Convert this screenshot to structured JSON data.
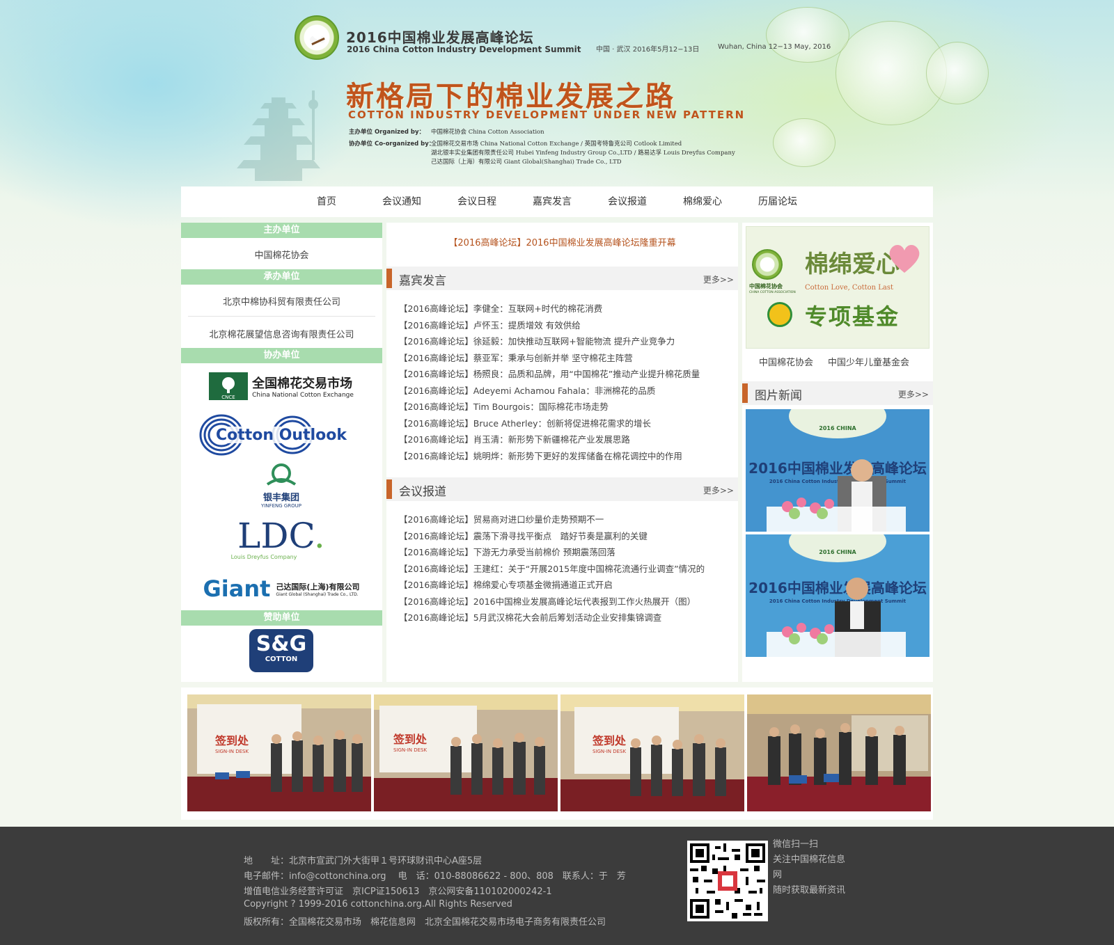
{
  "header": {
    "summit_cn": "2016中国棉业发展高峰论坛",
    "summit_en": "2016 China Cotton Industry Development Summit",
    "date_cn": "中国 · 武汉  2016年5月12−13日",
    "date_en": "Wuhan, China  12−13  May, 2016",
    "slogan_cn": "新格局下的棉业发展之路",
    "slogan_en": "COTTON INDUSTRY DEVELOPMENT UNDER NEW PATTERN",
    "organized_label": "主办单位  Organized by：",
    "organized_value": "中国棉花协会  China Cotton Association",
    "coorganized_label": "协办单位  Co-organized by：",
    "coorganized_line1": "全国棉花交易市场  China National Cotton Exchange   /   英国考特鲁克公司  Cotlook Limited",
    "coorganized_line2": "湖北银丰实业集团有限责任公司  Hubei Yinfeng Industry Group Co.,LTD   /   路易达孚  Louis Dreyfus Company",
    "coorganized_line3": "己达国际（上海）有限公司  Giant Global(Shanghai) Trade Co., LTD"
  },
  "nav": {
    "items": [
      "首页",
      "会议通知",
      "会议日程",
      "嘉宾发言",
      "会议报道",
      "棉绵爱心",
      "历届论坛"
    ]
  },
  "left": {
    "host_title": "主办单位",
    "host_items": [
      "中国棉花协会"
    ],
    "undertake_title": "承办单位",
    "undertake_items": [
      "北京中棉协科贸有限责任公司",
      "北京棉花展望信息咨询有限责任公司"
    ],
    "coorg_title": "协办单位",
    "sponsor_title": "赞助单位",
    "logos": {
      "cnce_cn": "全国棉花交易市场",
      "cnce_en": "China National Cotton Exchange",
      "cnce_mark": "CNCE",
      "cotlook": "Cotton Outlook",
      "yinfeng_cn": "银丰集团",
      "yinfeng_en": "YINFENG GROUP",
      "ldc": "LDC",
      "ldc_sub": "Louis Dreyfus Company",
      "giant": "Giant",
      "giant_cn": "己达国际(上海)有限公司",
      "giant_en": "Giant Global (Shanghai) Trade Co., LTD.",
      "sg": "S&G",
      "sg_sub": "COTTON"
    }
  },
  "center": {
    "headline": "【2016高峰论坛】2016中国棉业发展高峰论坛隆重开幕",
    "speech_title": "嘉宾发言",
    "speech_more": "更多>>",
    "speeches": [
      "【2016高峰论坛】李健全：互联网+时代的棉花消费",
      "【2016高峰论坛】卢怀玉：提质增效 有效供给",
      "【2016高峰论坛】徐延毅：加快推动互联网+智能物流 提升产业竞争力",
      "【2016高峰论坛】蔡亚军：秉承与创新并举 坚守棉花主阵营",
      "【2016高峰论坛】杨照良：品质和品牌，用“中国棉花”推动产业提升棉花质量",
      "【2016高峰论坛】Adeyemi Achamou Fahala：非洲棉花的品质",
      "【2016高峰论坛】Tim Bourgois：国际棉花市场走势",
      "【2016高峰论坛】Bruce Atherley：创新将促进棉花需求的增长",
      "【2016高峰论坛】肖玉清：新形势下新疆棉花产业发展思路",
      "【2016高峰论坛】姚明烨：新形势下更好的发挥储备在棉花调控中的作用"
    ],
    "report_title": "会议报道",
    "report_more": "更多>>",
    "reports": [
      "【2016高峰论坛】贸易商对进口纱量价走势预期不一",
      "【2016高峰论坛】震荡下滑寻找平衡点　踏好节奏是赢利的关键",
      "【2016高峰论坛】下游无力承受当前棉价 预期震荡回落",
      "【2016高峰论坛】王建红：关于“开展2015年度中国棉花流通行业调查”情况的",
      "【2016高峰论坛】棉绵爱心专项基金微捐通道正式开启",
      "【2016高峰论坛】2016中国棉业发展高峰论坛代表报到工作火热展开（图）",
      "【2016高峰论坛】5月武汉棉花大会前后筹划活动企业安排集锦调查"
    ]
  },
  "right": {
    "charity_title": "棉绵爱心",
    "charity_en": "Cotton Love, Cotton Last",
    "charity_fund": "专项基金",
    "charity_org": "中国棉花协会",
    "charity_org_en": "CHINA COTTON ASSOCIATION",
    "caption_left": "中国棉花协会",
    "caption_right": "中国少年儿童基金会",
    "photo_news_title": "图片新闻",
    "photo_news_more": "更多>>",
    "banner_cn": "2016中国棉业发展高峰论坛",
    "banner_en": "2016 China Cotton Industry Development Summit",
    "banner_badge": "2016 CHINA"
  },
  "strip": {
    "sign_cn": "签到处",
    "sign_en": "SIGN-IN DESK"
  },
  "footer": {
    "address": "地　　址：北京市宣武门外大街甲１号环球财讯中心A座5层",
    "contact": "电子邮件：info@cottonchina.org　 电　话：010-88086622 - 800、808　联系人：于　芳",
    "license": "增值电信业务经营许可证　京ICP证150613　京公网安备110102000242-1",
    "copyright": "Copyright ? 1999-2016 cottonchina.org.All Rights Reserved",
    "owner": "版权所有：全国棉花交易市场　棉花信息网　北京全国棉花交易市场电子商务有限责任公司",
    "qr_text_1": "微信扫一扫",
    "qr_text_2": "关注中国棉花信息",
    "qr_text_3": "网",
    "qr_text_4": "随时获取最新资讯"
  },
  "colors": {
    "accent": "#c8652a",
    "side_header": "#a8dcae",
    "headline": "#b5531e",
    "footer_bg": "#3c3c3c"
  },
  "icons": {
    "summit_logo": "cotton-boll-logo",
    "qr": "wechat-qr-code"
  }
}
